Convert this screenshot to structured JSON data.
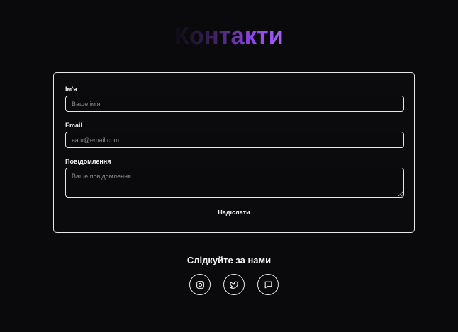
{
  "header": {
    "title": "Контакти"
  },
  "form": {
    "name": {
      "label": "Ім'я",
      "placeholder": "Ваше ім'я"
    },
    "email": {
      "label": "Email",
      "placeholder": "ваш@email.com"
    },
    "message": {
      "label": "Повідомлення",
      "placeholder": "Ваше повідомлення..."
    },
    "submit_label": "Надіслати"
  },
  "social": {
    "heading": "Слідкуйте за нами",
    "links": [
      {
        "icon": "instagram-icon"
      },
      {
        "icon": "twitter-icon"
      },
      {
        "icon": "message-icon"
      }
    ]
  },
  "colors": {
    "background": "#0a0a0c",
    "accent": "#a35ff7",
    "border": "#e8e8e8"
  }
}
